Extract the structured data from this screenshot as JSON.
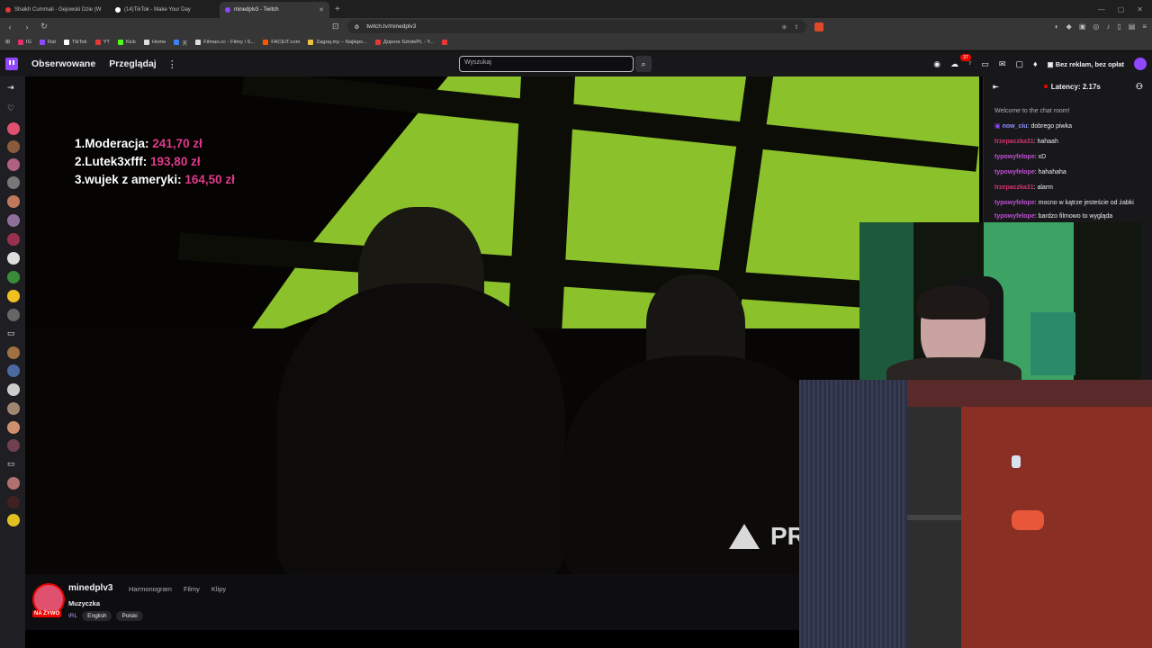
{
  "browser": {
    "tabs": [
      {
        "title": "Shaikh Cummali - Gejowski Dzie (W",
        "color": "#e53935"
      },
      {
        "title": "(14)TikTok - Make Your Day",
        "color": "#ffffff"
      },
      {
        "title": "minedplv3 - Twitch",
        "color": "#9147ff"
      }
    ],
    "new_tab": "+",
    "url": "twitch.tv/minedplv3",
    "bookmarks": [
      "IG",
      "Rat",
      "TikTok",
      "YT",
      "Kick",
      "Home",
      "天",
      "Filman.cc - Filmy i S...",
      "FACEIT.com",
      "Zagraj.my – Najleps...",
      "Доpora SztolePL - Y..."
    ]
  },
  "twitch_nav": {
    "following": "Obserwowane",
    "browse": "Przeglądaj",
    "more": "⋮",
    "search_placeholder": "Wyszukaj",
    "notification_count": "37",
    "ad_free": "Bez reklam, bez opłat"
  },
  "overlay": {
    "leaderboard": [
      {
        "rank_name": "1.Moderacja:",
        "amount": "241,70 zł"
      },
      {
        "rank_name": "2.Lutek3xfff:",
        "amount": "193,80 zł"
      },
      {
        "rank_name": "3.wujek z ameryki:",
        "amount": "164,50 zł"
      }
    ],
    "logo_text": "PR"
  },
  "chat": {
    "latency": "Latency: 2.17s",
    "welcome": "Welcome to the chat room!",
    "messages": [
      {
        "user": "now_ciu",
        "text": ": dobrego piwka"
      },
      {
        "user": "trzepaczka31",
        "text": ": hahaah"
      },
      {
        "user": "typowyfelope",
        "text": ": xD"
      },
      {
        "user": "typowyfelope",
        "text": ": hahahaha"
      },
      {
        "user": "trzepaczka31",
        "text": ": alarm"
      },
      {
        "user": "typowyfelope",
        "text": ": mocno w kątrze jesteście od żabki"
      },
      {
        "user": "typowyfelope",
        "text": ": bardzo filmowo to wygląda"
      }
    ]
  },
  "channel": {
    "name": "minedplv3",
    "live": "NA ŻYWO",
    "links": [
      "Harmonogram",
      "Filmy",
      "Klipy"
    ],
    "category": "Muzyczka",
    "tag_irl": "IRL",
    "tags": [
      "English",
      "Polski"
    ]
  }
}
